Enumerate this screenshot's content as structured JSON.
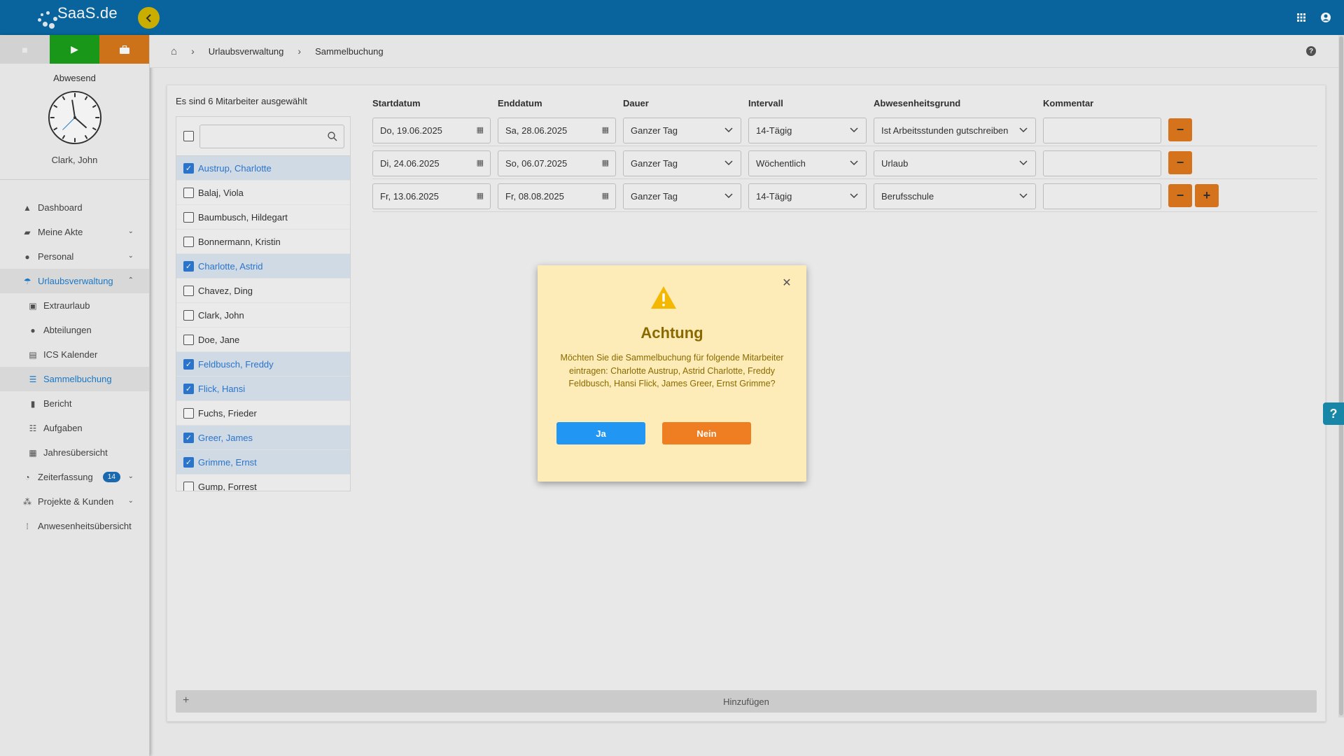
{
  "app": {
    "logo_text": "SaaS.de"
  },
  "sidebar": {
    "status": "Abwesend",
    "user_name": "Clark, John",
    "nav": [
      {
        "label": "Dashboard"
      },
      {
        "label": "Meine Akte"
      },
      {
        "label": "Personal"
      },
      {
        "label": "Urlaubsverwaltung"
      },
      {
        "label": "Extraurlaub"
      },
      {
        "label": "Abteilungen"
      },
      {
        "label": "ICS Kalender"
      },
      {
        "label": "Sammelbuchung"
      },
      {
        "label": "Bericht"
      },
      {
        "label": "Aufgaben"
      },
      {
        "label": "Jahresübersicht"
      },
      {
        "label": "Zeiterfassung",
        "badge": "14"
      },
      {
        "label": "Projekte & Kunden"
      },
      {
        "label": "Anwesenheitsübersicht"
      }
    ]
  },
  "breadcrumb": {
    "items": [
      "Urlaubsverwaltung",
      "Sammelbuchung"
    ]
  },
  "employees": {
    "selection_info": "Es sind 6 Mitarbeiter ausgewählt",
    "search_placeholder": "",
    "rows": [
      {
        "name": "Austrup, Charlotte",
        "checked": true
      },
      {
        "name": "Balaj, Viola",
        "checked": false
      },
      {
        "name": "Baumbusch, Hildegart",
        "checked": false
      },
      {
        "name": "Bonnermann, Kristin",
        "checked": false
      },
      {
        "name": "Charlotte, Astrid",
        "checked": true
      },
      {
        "name": "Chavez, Ding",
        "checked": false
      },
      {
        "name": "Clark, John",
        "checked": false
      },
      {
        "name": "Doe, Jane",
        "checked": false
      },
      {
        "name": "Feldbusch, Freddy",
        "checked": true
      },
      {
        "name": "Flick, Hansi",
        "checked": true
      },
      {
        "name": "Fuchs, Frieder",
        "checked": false
      },
      {
        "name": "Greer, James",
        "checked": true
      },
      {
        "name": "Grimme, Ernst",
        "checked": true
      },
      {
        "name": "Gump, Forrest",
        "checked": false
      }
    ]
  },
  "booking": {
    "columns": {
      "start": "Startdatum",
      "end": "Enddatum",
      "duration": "Dauer",
      "interval": "Intervall",
      "reason": "Abwesenheitsgrund",
      "comment": "Kommentar"
    },
    "rows": [
      {
        "start": "Do, 19.06.2025",
        "end": "Sa, 28.06.2025",
        "duration": "Ganzer Tag",
        "interval": "14-Tägig",
        "reason": "Ist Arbeitsstunden gutschreiben",
        "comment": ""
      },
      {
        "start": "Di, 24.06.2025",
        "end": "So, 06.07.2025",
        "duration": "Ganzer Tag",
        "interval": "Wöchentlich",
        "reason": "Urlaub",
        "comment": ""
      },
      {
        "start": "Fr, 13.06.2025",
        "end": "Fr, 08.08.2025",
        "duration": "Ganzer Tag",
        "interval": "14-Tägig",
        "reason": "Berufsschule",
        "comment": ""
      }
    ],
    "remove_label": "−",
    "add_row_label": "+",
    "add_bar_label": "Hinzufügen"
  },
  "dialog": {
    "title": "Achtung",
    "message": "Möchten Sie die Sammelbuchung für folgende Mitarbeiter eintragen: Charlotte Austrup, Astrid Charlotte, Freddy Feldbusch, Hansi Flick, James Greer, Ernst Grimme?",
    "yes_label": "Ja",
    "no_label": "Nein"
  },
  "colors": {
    "topbar": "#0a6aa6",
    "accent_blue": "#1b7fd1",
    "orange": "#e07a1d",
    "dialog_bg": "#fdecb8",
    "dialog_text": "#8a6a00"
  }
}
